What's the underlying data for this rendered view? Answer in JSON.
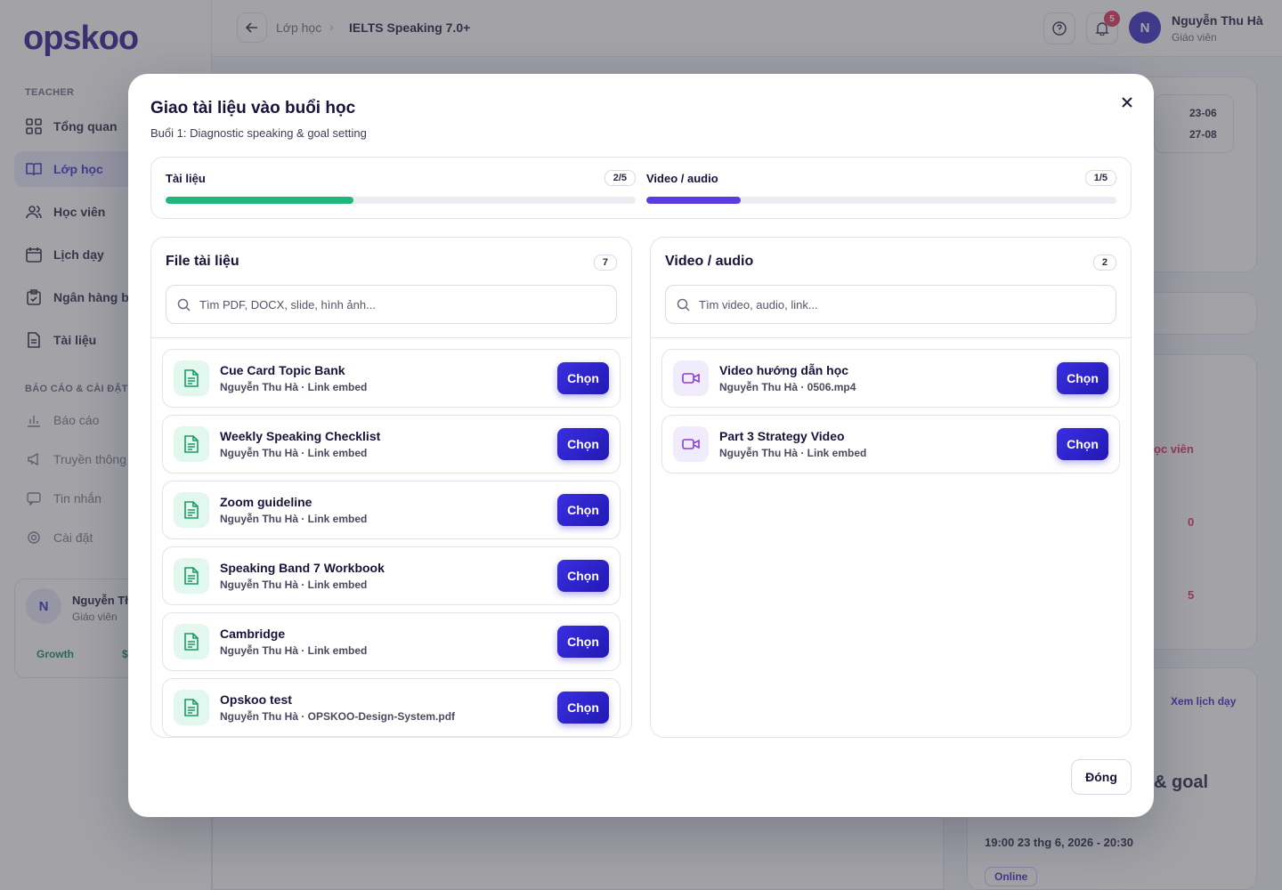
{
  "app": {
    "logo": "opskoo",
    "sidebar": {
      "section_teacher": "TEACHER",
      "section_reports": "BÁO CÁO & CÀI ĐẶT",
      "items": [
        {
          "label": "Tổng quan",
          "icon": "grid-icon"
        },
        {
          "label": "Lớp học",
          "icon": "book-icon",
          "active": true
        },
        {
          "label": "Học viên",
          "icon": "users-icon"
        },
        {
          "label": "Lịch dạy",
          "icon": "calendar-icon"
        },
        {
          "label": "Ngân hàng bà",
          "icon": "clipboard-icon"
        },
        {
          "label": "Tài liệu",
          "icon": "file-icon"
        }
      ],
      "report_items": [
        {
          "label": "Báo cáo",
          "icon": "chart-icon"
        },
        {
          "label": "Truyền thông",
          "icon": "megaphone-icon"
        },
        {
          "label": "Tin nhắn",
          "icon": "message-icon"
        },
        {
          "label": "Cài đặt",
          "icon": "gear-icon"
        }
      ],
      "user": {
        "initial": "N",
        "name": "Nguyễn Tł",
        "role": "Giáo viên",
        "plan": "Growth",
        "plan_suffix": "$"
      }
    },
    "topbar": {
      "breadcrumb_parent": "Lớp học",
      "breadcrumb_current": "IELTS Speaking 7.0+",
      "notifications": "5",
      "user_initial": "N",
      "user_name": "Nguyễn Thu Hà",
      "user_role": "Giáo viên"
    },
    "background": {
      "date1": "23-06",
      "date2": "27-08",
      "link_students": "ọc viên",
      "count_a": "0",
      "count_b": "5",
      "schedule_link": "Xem lịch dạy",
      "goal_text": "& goal",
      "datetime": "19:00 23 thg 6, 2026 - 20:30",
      "mode": "Online"
    }
  },
  "modal": {
    "title": "Giao tài liệu vào buổi học",
    "subtitle": "Buổi 1: Diagnostic speaking & goal setting",
    "close_label": "×",
    "progress": {
      "docs": {
        "label": "Tài liệu",
        "count": "2/5",
        "fraction": 0.4,
        "color": "#1fb77a"
      },
      "video": {
        "label": "Video / audio",
        "count": "1/5",
        "fraction": 0.2,
        "color": "#5b3ce0"
      }
    },
    "docs_panel": {
      "title": "File tài liệu",
      "count": "7",
      "search_placeholder": "Tìm PDF, DOCX, slide, hình ảnh...",
      "items": [
        {
          "title": "Cue Card Topic Bank",
          "meta": "Nguyễn Thu Hà · Link embed",
          "action": "Chọn"
        },
        {
          "title": "Weekly Speaking Checklist",
          "meta": "Nguyễn Thu Hà · Link embed",
          "action": "Chọn"
        },
        {
          "title": "Zoom guideline",
          "meta": "Nguyễn Thu Hà · Link embed",
          "action": "Chọn"
        },
        {
          "title": "Speaking Band 7 Workbook",
          "meta": "Nguyễn Thu Hà · Link embed",
          "action": "Chọn"
        },
        {
          "title": "Cambridge",
          "meta": "Nguyễn Thu Hà · Link embed",
          "action": "Chọn"
        },
        {
          "title": "Opskoo test",
          "meta": "Nguyễn Thu Hà · OPSKOO-Design-System.pdf",
          "action": "Chọn"
        }
      ]
    },
    "video_panel": {
      "title": "Video / audio",
      "count": "2",
      "search_placeholder": "Tìm video, audio, link...",
      "items": [
        {
          "title": "Video hướng dẫn học",
          "meta": "Nguyễn Thu Hà · 0506.mp4",
          "action": "Chọn"
        },
        {
          "title": "Part 3 Strategy Video",
          "meta": "Nguyễn Thu Hà · Link embed",
          "action": "Chọn"
        }
      ]
    },
    "footer_close": "Đóng"
  }
}
